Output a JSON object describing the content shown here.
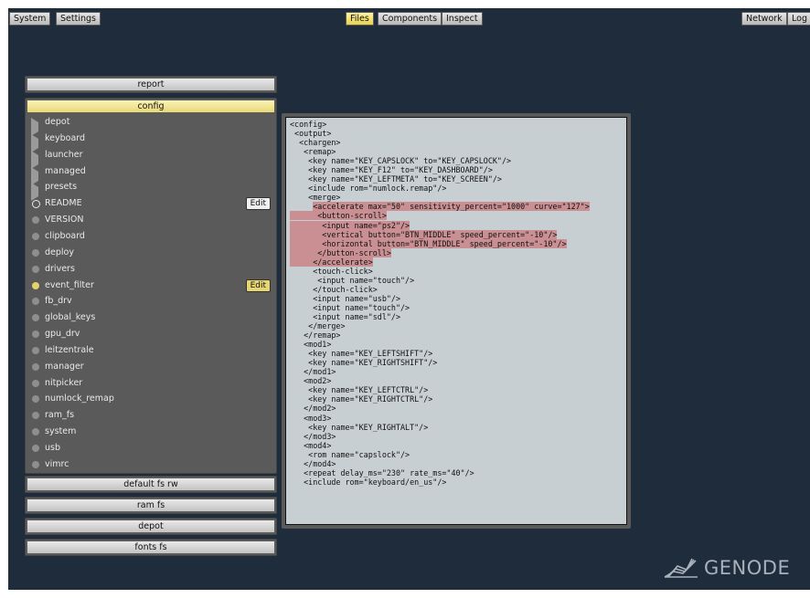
{
  "topbar": {
    "left": [
      "System",
      "Settings"
    ],
    "center": [
      {
        "label": "Files",
        "active": true
      },
      {
        "label": "Components",
        "active": false
      },
      {
        "label": "Inspect",
        "active": false
      }
    ],
    "right": [
      "Network",
      "Log"
    ]
  },
  "sidebar": {
    "report": "report",
    "config": {
      "title": "config",
      "items": [
        {
          "label": "depot",
          "icon": "folder-triangle-icon"
        },
        {
          "label": "keyboard",
          "icon": "folder-triangle-icon"
        },
        {
          "label": "launcher",
          "icon": "folder-triangle-icon"
        },
        {
          "label": "managed",
          "icon": "folder-triangle-icon"
        },
        {
          "label": "presets",
          "icon": "folder-triangle-icon"
        },
        {
          "label": "README",
          "icon": "ring-icon",
          "edit": "Edit",
          "edit_style": "light"
        },
        {
          "label": "VERSION",
          "icon": "dot-icon"
        },
        {
          "label": "clipboard",
          "icon": "dot-icon"
        },
        {
          "label": "deploy",
          "icon": "dot-icon"
        },
        {
          "label": "drivers",
          "icon": "dot-icon"
        },
        {
          "label": "event_filter",
          "icon": "dot-yellow-icon",
          "edit": "Edit",
          "edit_style": "yellow"
        },
        {
          "label": "fb_drv",
          "icon": "dot-icon"
        },
        {
          "label": "global_keys",
          "icon": "dot-icon"
        },
        {
          "label": "gpu_drv",
          "icon": "dot-icon"
        },
        {
          "label": "leitzentrale",
          "icon": "dot-icon"
        },
        {
          "label": "manager",
          "icon": "dot-icon"
        },
        {
          "label": "nitpicker",
          "icon": "dot-icon"
        },
        {
          "label": "numlock_remap",
          "icon": "dot-icon"
        },
        {
          "label": "ram_fs",
          "icon": "dot-icon"
        },
        {
          "label": "system",
          "icon": "dot-icon"
        },
        {
          "label": "usb",
          "icon": "dot-icon"
        },
        {
          "label": "vimrc",
          "icon": "dot-icon"
        }
      ]
    },
    "bottom_buttons": [
      "default fs rw",
      "ram fs",
      "depot",
      "fonts fs"
    ]
  },
  "editor": {
    "lines": [
      {
        "text": "<config>"
      },
      {
        "text": " <output>"
      },
      {
        "text": "  <chargen>"
      },
      {
        "text": "   <remap>"
      },
      {
        "text": "    <key name=\"KEY_CAPSLOCK\" to=\"KEY_CAPSLOCK\"/>"
      },
      {
        "text": "    <key name=\"KEY_F12\" to=\"KEY_DASHBOARD\"/>"
      },
      {
        "text": "    <key name=\"KEY_LEFTMETA\" to=\"KEY_SCREEN\"/>"
      },
      {
        "text": "    <include rom=\"numlock.remap\"/>"
      },
      {
        "text": "    <merge>"
      },
      {
        "pre": "     ",
        "hl": "<accelerate max=\"50\" sensitivity_percent=\"1000\" curve=\"127\">"
      },
      {
        "hl": "      <button-scroll>"
      },
      {
        "hl": "       <input name=\"ps2\"/>"
      },
      {
        "hl": "       <vertical button=\"BTN_MIDDLE\" speed_percent=\"-10\"/>"
      },
      {
        "hl": "       <horizontal button=\"BTN_MIDDLE\" speed_percent=\"-10\"/>"
      },
      {
        "hl": "      </button-scroll>"
      },
      {
        "hl": "     </accelerate>"
      },
      {
        "text": "     <touch-click>"
      },
      {
        "text": "      <input name=\"touch\"/>"
      },
      {
        "text": "     </touch-click>"
      },
      {
        "text": "     <input name=\"usb\"/>"
      },
      {
        "text": "     <input name=\"touch\"/>"
      },
      {
        "text": "     <input name=\"sdl\"/>"
      },
      {
        "text": "    </merge>"
      },
      {
        "text": "   </remap>"
      },
      {
        "text": "   <mod1>"
      },
      {
        "text": "    <key name=\"KEY_LEFTSHIFT\"/>"
      },
      {
        "text": "    <key name=\"KEY_RIGHTSHIFT\"/>"
      },
      {
        "text": "   </mod1>"
      },
      {
        "text": "   <mod2>"
      },
      {
        "text": "    <key name=\"KEY_LEFTCTRL\"/>"
      },
      {
        "text": "    <key name=\"KEY_RIGHTCTRL\"/>"
      },
      {
        "text": "   </mod2>"
      },
      {
        "text": "   <mod3>"
      },
      {
        "text": "    <key name=\"KEY_RIGHTALT\"/>"
      },
      {
        "text": "   </mod3>"
      },
      {
        "text": "   <mod4>"
      },
      {
        "text": "    <rom name=\"capslock\"/>"
      },
      {
        "text": "   </mod4>"
      },
      {
        "text": "   <repeat delay_ms=\"230\" rate_ms=\"40\"/>"
      },
      {
        "text": "   <include rom=\"keyboard/en_us\"/>"
      }
    ]
  },
  "branding": {
    "logo_text": "GENODE"
  },
  "colors": {
    "background": "#1f2c3c",
    "active_yellow": "#e7d877",
    "selection": "#c98f93",
    "editor_bg": "#c8cfd2"
  }
}
